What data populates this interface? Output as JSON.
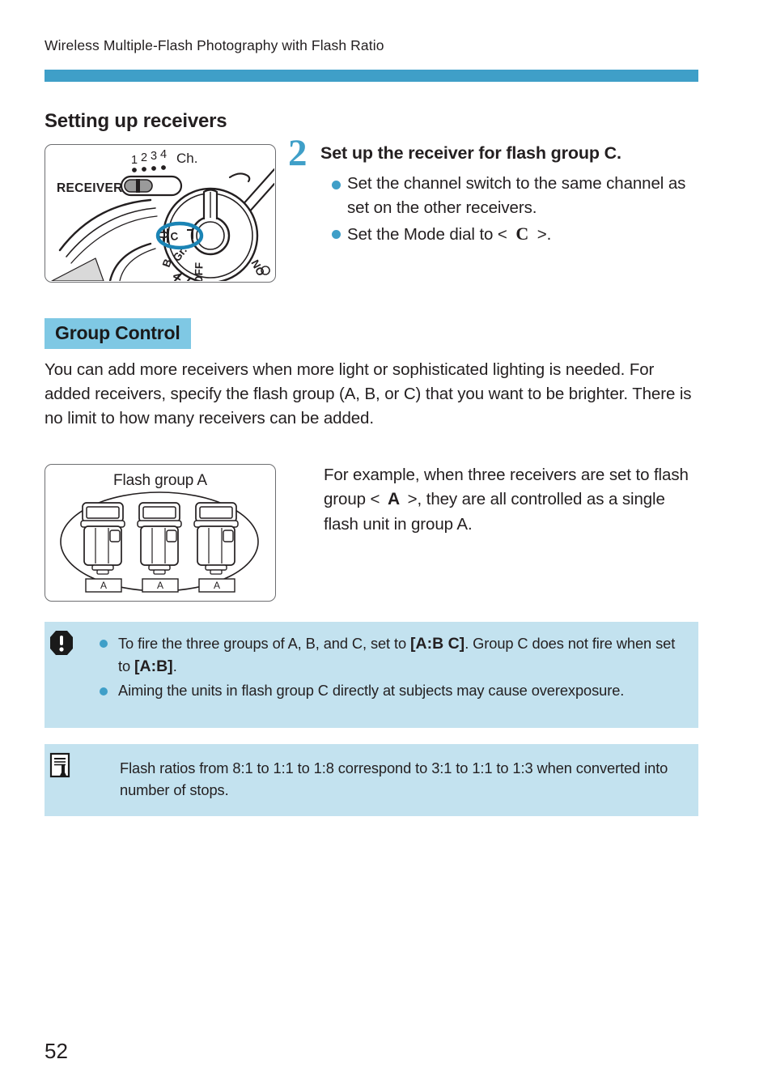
{
  "header": {
    "running_title": "Wireless Multiple-Flash Photography with Flash Ratio",
    "rule_color": "#3f9fc8"
  },
  "section": {
    "heading": "Setting up receivers"
  },
  "figure_receiver": {
    "name": "receiver-camera-diagram",
    "receiver_label": "RECEIVER",
    "channel_label": "Ch.",
    "channel_numbers": [
      "1",
      "2",
      "3",
      "4"
    ],
    "dial_labels": [
      "C",
      "Gr.",
      "B",
      "A",
      "OFF",
      "ON"
    ],
    "highlight_color": "#1b84b5",
    "highlighted_position": "C"
  },
  "step": {
    "number": "2",
    "number_color": "#3f9fc8",
    "title": "Set up the receiver for flash group C.",
    "bullets": [
      {
        "text_before": "Set the channel switch to the same channel as set on the other receivers.",
        "glyph": "",
        "text_after": ""
      },
      {
        "text_before": "Set the Mode dial to < ",
        "glyph": "C",
        "text_after": " >."
      }
    ]
  },
  "group_control": {
    "heading": "Group Control",
    "heading_bg": "#7fc8e4",
    "paragraph": "You can add more receivers when more light or sophisticated lighting is needed. For added receivers, specify the flash group (A, B, or C) that you want to be brighter. There is no limit to how many receivers can be added."
  },
  "figure_group": {
    "name": "flash-group-a-diagram",
    "title": "Flash group A",
    "unit_labels": [
      "A",
      "A",
      "A"
    ],
    "unit_count": 3
  },
  "example": {
    "text_before": "For example, when three receivers are set to flash group < ",
    "glyph": "A",
    "text_after": " >, they are all controlled as a single flash unit in group A."
  },
  "notes": [
    {
      "icon": "caution-exclamation-icon",
      "background": "#c3e2ef",
      "items": [
        {
          "seg1": "To fire the three groups of A, B, and C, set to ",
          "code1": "[A:B C]",
          "seg2": ". Group C does not fire when set to ",
          "code2": "[A:B]",
          "seg3": "."
        },
        {
          "seg1": "Aiming the units in flash group C directly at subjects may cause overexposure.",
          "code1": "",
          "seg2": "",
          "code2": "",
          "seg3": ""
        }
      ]
    },
    {
      "icon": "note-document-icon",
      "background": "#c3e2ef",
      "text": "Flash ratios from 8:1 to 1:1 to 1:8 correspond to 3:1 to 1:1 to 1:3 when converted into number of stops."
    }
  ],
  "page": {
    "number": "52"
  }
}
